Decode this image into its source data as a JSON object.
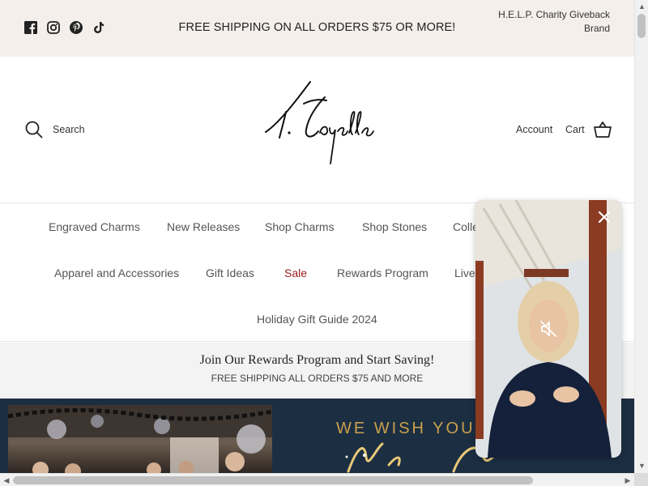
{
  "announcement": {
    "text": "FREE SHIPPING ON ALL ORDERS $75 OR MORE!",
    "right_link": "H.E.L.P. Charity Giveback Brand",
    "social_icons": [
      "facebook-icon",
      "instagram-icon",
      "pinterest-icon",
      "tiktok-icon"
    ]
  },
  "header": {
    "search_label": "Search",
    "account_label": "Account",
    "cart_label": "Cart"
  },
  "nav": {
    "row1": [
      "Engraved Charms",
      "New Releases",
      "Shop Charms",
      "Shop Stones",
      "Colle"
    ],
    "row2": [
      "Apparel and Accessories",
      "Gift Ideas",
      "Sale",
      "Rewards Program",
      "Live"
    ],
    "row3": [
      "Holiday Gift Guide 2024"
    ]
  },
  "promo": {
    "title": "Join Our Rewards Program and Start Saving!",
    "subtitle": "FREE SHIPPING ALL ORDERS $75 AND MORE"
  },
  "hero": {
    "headline": "WE WISH YOU"
  },
  "colors": {
    "announcement_bg": "#f4efeb",
    "sale_red": "#9c1b1b",
    "hero_gold": "#c9a04c",
    "hero_navy": "#1c2e42"
  }
}
